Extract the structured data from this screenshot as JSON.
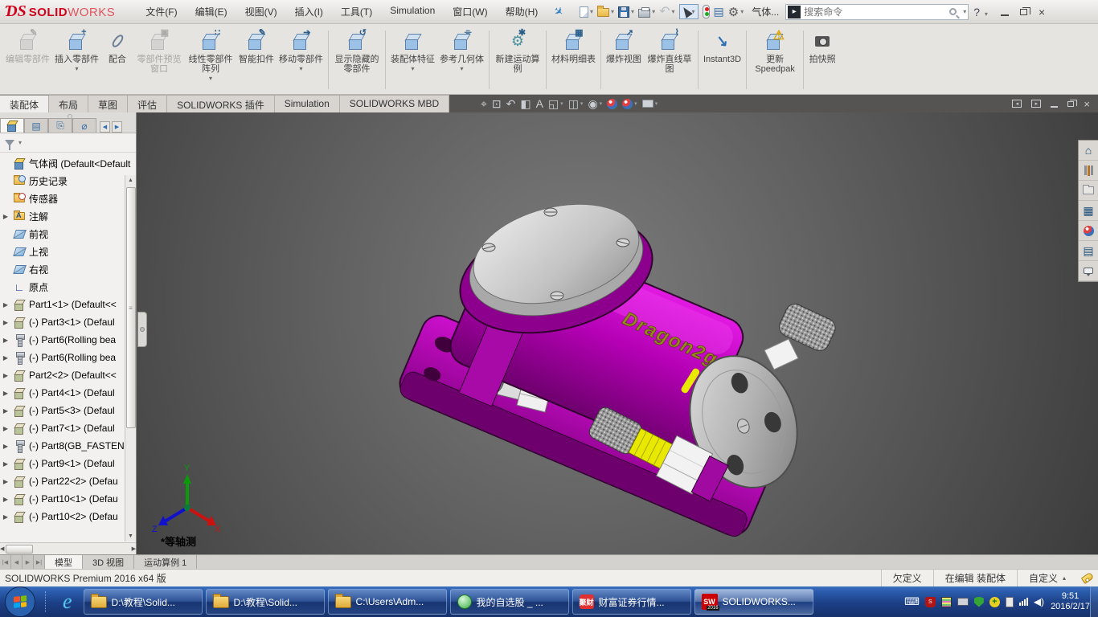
{
  "brand": {
    "ds": "ƊS",
    "solid": "SOLID",
    "works": "WORKS"
  },
  "menu": {
    "items": [
      "文件(F)",
      "编辑(E)",
      "视图(V)",
      "插入(I)",
      "工具(T)",
      "Simulation",
      "窗口(W)",
      "帮助(H)"
    ]
  },
  "qat": {
    "icons": [
      "new-file-icon",
      "open-file-icon",
      "save-icon",
      "print-icon",
      "undo-icon",
      "select-arrow-icon",
      "rebuild-traffic-light-icon",
      "options-list-icon",
      "settings-gear-icon"
    ],
    "doc_short": "气体...",
    "search_placeholder": "搜索命令",
    "help": "?"
  },
  "ribbon": {
    "buttons": [
      {
        "label": "编辑零部件",
        "icon": "edit-component-icon",
        "enabled": false,
        "dropdown": false
      },
      {
        "label": "插入零部件",
        "icon": "insert-component-icon",
        "enabled": true,
        "dropdown": true
      },
      {
        "label": "配合",
        "icon": "mate-paperclip-icon",
        "enabled": true,
        "dropdown": false
      },
      {
        "label": "零部件预览窗口",
        "icon": "component-preview-icon",
        "enabled": false,
        "dropdown": false
      },
      {
        "label": "线性零部件阵列",
        "icon": "linear-component-pattern-icon",
        "enabled": true,
        "dropdown": true
      },
      {
        "label": "智能扣件",
        "icon": "smart-fasteners-icon",
        "enabled": true,
        "dropdown": false
      },
      {
        "label": "移动零部件",
        "icon": "move-component-icon",
        "enabled": true,
        "dropdown": true
      },
      {
        "label": "显示隐藏的零部件",
        "icon": "show-hidden-components-icon",
        "enabled": true,
        "dropdown": false
      },
      {
        "label": "装配体特征",
        "icon": "assembly-features-icon",
        "enabled": true,
        "dropdown": true
      },
      {
        "label": "参考几何体",
        "icon": "reference-geometry-icon",
        "enabled": true,
        "dropdown": true
      },
      {
        "label": "新建运动算例",
        "icon": "new-motion-study-icon",
        "enabled": true,
        "dropdown": false
      },
      {
        "label": "材料明细表",
        "icon": "bill-of-materials-icon",
        "enabled": true,
        "dropdown": false
      },
      {
        "label": "爆炸视图",
        "icon": "exploded-view-icon",
        "enabled": true,
        "dropdown": false
      },
      {
        "label": "爆炸直线草图",
        "icon": "explode-line-sketch-icon",
        "enabled": true,
        "dropdown": false
      },
      {
        "label": "Instant3D",
        "icon": "instant3d-icon",
        "enabled": true,
        "dropdown": false
      },
      {
        "label": "更新Speedpak",
        "icon": "update-speedpak-icon",
        "enabled": true,
        "dropdown": false
      },
      {
        "label": "拍快照",
        "icon": "take-snapshot-icon",
        "enabled": true,
        "dropdown": false
      }
    ]
  },
  "tabs": {
    "items": [
      {
        "label": "装配体",
        "active": true
      },
      {
        "label": "布局",
        "active": false
      },
      {
        "label": "草图",
        "active": false
      },
      {
        "label": "评估",
        "active": false
      },
      {
        "label": "SOLIDWORKS 插件",
        "active": false
      },
      {
        "label": "Simulation",
        "active": false
      },
      {
        "label": "SOLIDWORKS MBD",
        "active": false
      }
    ]
  },
  "headsup": {
    "icons": [
      "zoom-fit-icon",
      "zoom-area-icon",
      "previous-view-icon",
      "section-view-icon",
      "annotation-visibility-icon",
      "view-orientation-icon",
      "display-style-icon",
      "hide-show-items-icon",
      "edit-appearance-icon",
      "apply-scene-icon",
      "view-settings-icon"
    ]
  },
  "doc_controls": {
    "icons": [
      "pane-left-icon",
      "pane-right-icon",
      "minimize-icon",
      "restore-icon",
      "close-icon"
    ]
  },
  "panel": {
    "tabs": [
      "featuremanager-tab",
      "propertymanager-tab",
      "configurationmanager-tab",
      "dimxpertmanager-tab"
    ],
    "tree": [
      {
        "label": "气体阀 (Default<Default",
        "icon": "assembly-icon",
        "arrow": false
      },
      {
        "label": "历史记录",
        "icon": "history-folder-icon",
        "arrow": false
      },
      {
        "label": "传感器",
        "icon": "sensors-folder-icon",
        "arrow": false
      },
      {
        "label": "注解",
        "icon": "annotations-folder-icon",
        "arrow": true
      },
      {
        "label": "前视",
        "icon": "plane-icon",
        "arrow": false
      },
      {
        "label": "上视",
        "icon": "plane-icon",
        "arrow": false
      },
      {
        "label": "右视",
        "icon": "plane-icon",
        "arrow": false
      },
      {
        "label": "原点",
        "icon": "origin-icon",
        "arrow": false
      },
      {
        "label": "Part1<1> (Default<<",
        "icon": "part-icon",
        "arrow": true
      },
      {
        "label": "(-) Part3<1> (Defaul",
        "icon": "part-icon",
        "arrow": true
      },
      {
        "label": "(-) Part6(Rolling bea",
        "icon": "bolt-icon",
        "arrow": true
      },
      {
        "label": "(-) Part6(Rolling bea",
        "icon": "bolt-icon",
        "arrow": true
      },
      {
        "label": "Part2<2> (Default<<",
        "icon": "part-icon",
        "arrow": true
      },
      {
        "label": "(-) Part4<1> (Defaul",
        "icon": "part-icon",
        "arrow": true
      },
      {
        "label": "(-) Part5<3> (Defaul",
        "icon": "part-icon",
        "arrow": true
      },
      {
        "label": "(-) Part7<1> (Defaul",
        "icon": "part-icon",
        "arrow": true
      },
      {
        "label": "(-) Part8(GB_FASTEN",
        "icon": "bolt-icon",
        "arrow": true
      },
      {
        "label": "(-) Part9<1> (Defaul",
        "icon": "part-icon",
        "arrow": true
      },
      {
        "label": "(-) Part22<2> (Defau",
        "icon": "part-icon",
        "arrow": true
      },
      {
        "label": "(-) Part10<1> (Defau",
        "icon": "part-icon",
        "arrow": true
      },
      {
        "label": "(-) Part10<2> (Defau",
        "icon": "part-icon",
        "arrow": true
      }
    ]
  },
  "viewport": {
    "view_label": "*等轴测",
    "model_text": "Dragon2g",
    "triad": {
      "x": "X",
      "y": "Y",
      "z": "Z"
    },
    "colors": {
      "body_magenta": "#c000c0",
      "cap_gray": "#c6c6c6",
      "thread_yellow": "#e8e800"
    }
  },
  "taskpane": {
    "icons": [
      "home-icon",
      "design-library-icon",
      "file-explorer-icon",
      "view-palette-icon",
      "appearances-icon",
      "custom-properties-icon",
      "forum-icon"
    ]
  },
  "bottom": {
    "nav_icons": [
      "first-tab-icon",
      "prev-tab-icon",
      "next-tab-icon",
      "last-tab-icon"
    ],
    "tabs": [
      {
        "label": "模型",
        "active": true
      },
      {
        "label": "3D 视图",
        "active": false
      },
      {
        "label": "运动算例 1",
        "active": false
      }
    ]
  },
  "status": {
    "product": "SOLIDWORKS Premium 2016 x64 版",
    "state": "欠定义",
    "editing": "在编辑 装配体",
    "custom": "自定义"
  },
  "taskbar": {
    "buttons": [
      {
        "label": "D:\\教程\\Solid...",
        "icon": "folder-icon",
        "active": false
      },
      {
        "label": "D:\\教程\\Solid...",
        "icon": "folder-icon",
        "active": false
      },
      {
        "label": "C:\\Users\\Adm...",
        "icon": "folder-icon",
        "active": false
      },
      {
        "label": "我的自选股 _ ...",
        "icon": "browser-green-icon",
        "active": false
      },
      {
        "label": "财富证券行情...",
        "icon": "jucai-red-icon",
        "active": false
      },
      {
        "label": "SOLIDWORKS...",
        "icon": "solidworks-icon",
        "active": true
      }
    ],
    "jucai_glyph": "聚财",
    "sw_glyph": "SW",
    "tray_icons": [
      "keyboard-icon",
      "solidworks-shield-icon",
      "ime-list-icon",
      "monitor-icon",
      "shield-icon",
      "antivirus-plus-icon",
      "clipboard-icon",
      "network-signal-icon",
      "speaker-icon"
    ],
    "clock": {
      "time": "9:51",
      "date": "2016/2/17"
    }
  }
}
